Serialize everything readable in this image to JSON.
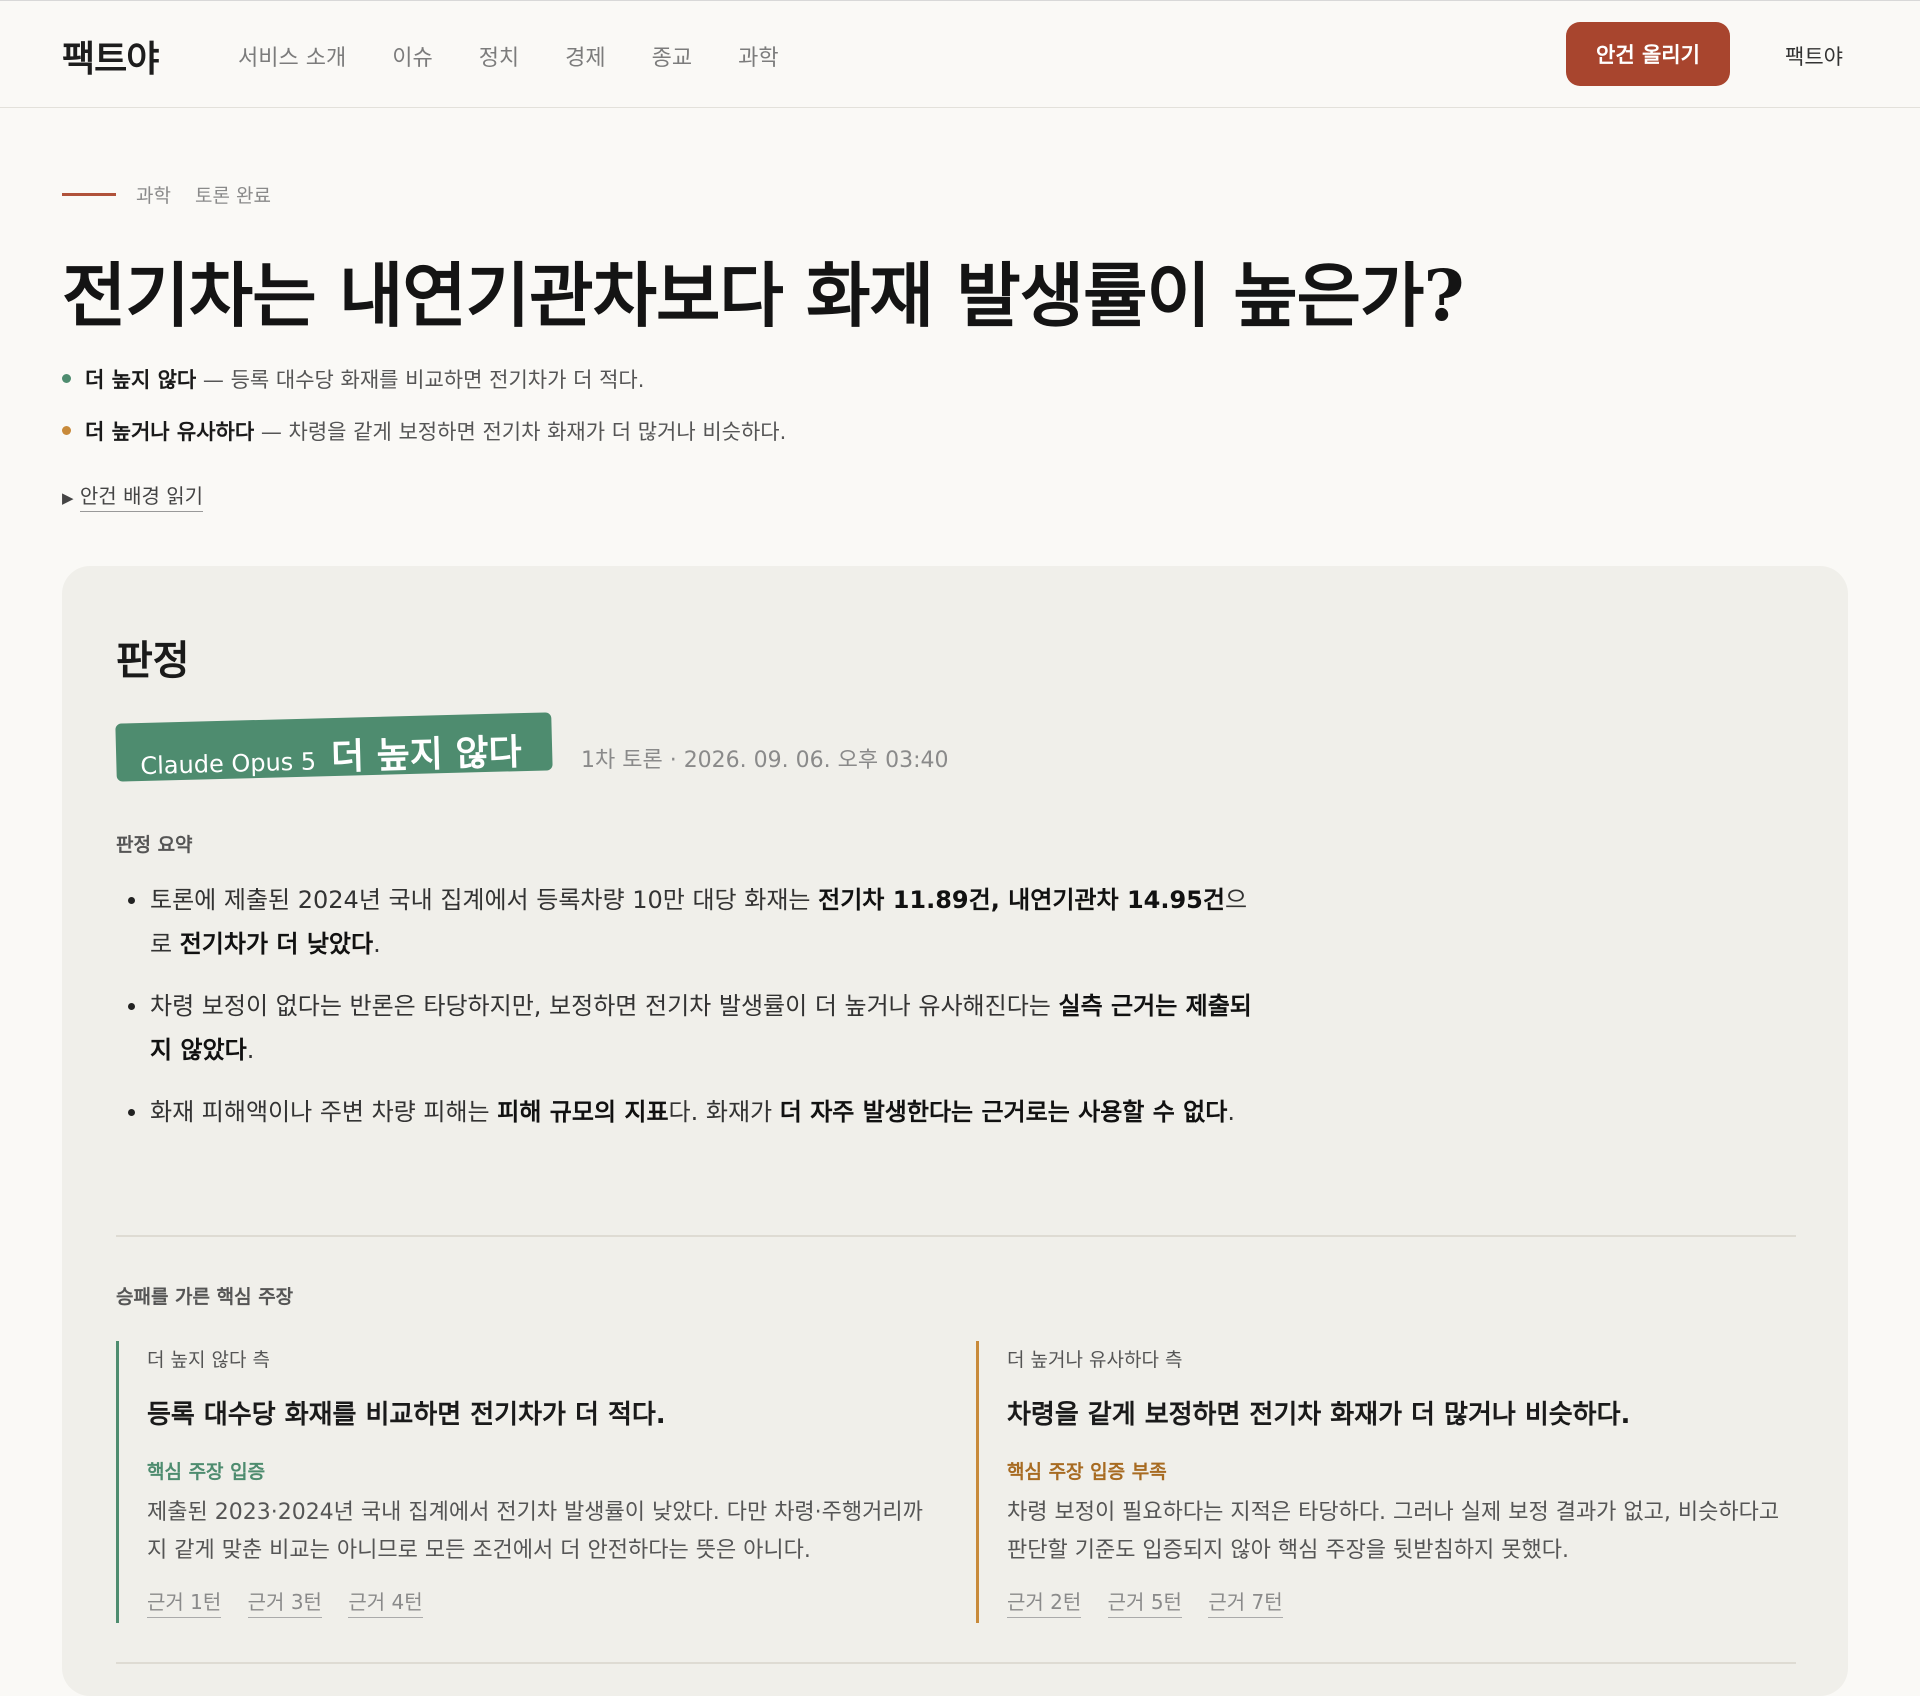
{
  "header": {
    "logo": "팩트야",
    "nav": [
      "서비스 소개",
      "이슈",
      "정치",
      "경제",
      "종교",
      "과학"
    ],
    "cta": "안건 올리기",
    "brand_right": "팩트야"
  },
  "breadcrumb": {
    "category": "과학",
    "status": "토론 완료"
  },
  "title": "전기차는 내연기관차보다 화재 발생률이 높은가?",
  "positions": [
    {
      "label": "더 높지 않다",
      "desc": " — 등록 대수당 화재를 비교하면 전기차가 더 적다.",
      "color": "#4e8c6f"
    },
    {
      "label": "더 높거나 유사하다",
      "desc": " — 차령을 같게 보정하면 전기차 화재가 더 많거나 비슷하다.",
      "color": "#c88a3a"
    }
  ],
  "background_link": {
    "arrow": "▶",
    "label": "안건 배경 읽기"
  },
  "verdict": {
    "heading": "판정",
    "model": "Claude Opus 5",
    "result": "더 높지 않다",
    "meta": "1차 토론 · 2026. 09. 06. 오후 03:40",
    "summary_label": "판정 요약",
    "summary": [
      {
        "a": "토론에 제출된 2024년 국내 집계에서 등록차량 10만 대당 화재는 ",
        "b": "전기차 11.89건, 내연기관차 14.95건",
        "c": "으로 ",
        "d": "전기차가 더 낮았다",
        "e": "."
      },
      {
        "a": "차령 보정이 없다는 반론은 타당하지만, 보정하면 전기차 발생률이 더 높거나 유사해진다는 ",
        "b": "실측 근거는 제출되지 않았다",
        "c": ".",
        "d": "",
        "e": ""
      },
      {
        "a": "화재 피해액이나 주변 차량 피해는 ",
        "b": "피해 규모의 지표",
        "c": "다. 화재가 ",
        "d": "더 자주 발생한다는 근거로는 사용할 수 없다",
        "e": "."
      }
    ],
    "key_label": "승패를 가른 핵심 주장",
    "sides": [
      {
        "side": "더 높지 않다 측",
        "claim": "등록 대수당 화재를 비교하면 전기차가 더 적다.",
        "status": "핵심 주장 입증",
        "desc": "제출된 2023·2024년 국내 집계에서 전기차 발생률이 낮았다. 다만 차령·주행거리까지 같게 맞춘 비교는 아니므로 모든 조건에서 더 안전하다는 뜻은 아니다.",
        "refs": [
          "근거 1턴",
          "근거 3턴",
          "근거 4턴"
        ]
      },
      {
        "side": "더 높거나 유사하다 측",
        "claim": "차령을 같게 보정하면 전기차 화재가 더 많거나 비슷하다.",
        "status": "핵심 주장 입증 부족",
        "desc": "차령 보정이 필요하다는 지적은 타당하다. 그러나 실제 보정 결과가 없고, 비슷하다고 판단할 기준도 입증되지 않아 핵심 주장을 뒷받침하지 못했다.",
        "refs": [
          "근거 2턴",
          "근거 5턴",
          "근거 7턴"
        ]
      }
    ]
  }
}
